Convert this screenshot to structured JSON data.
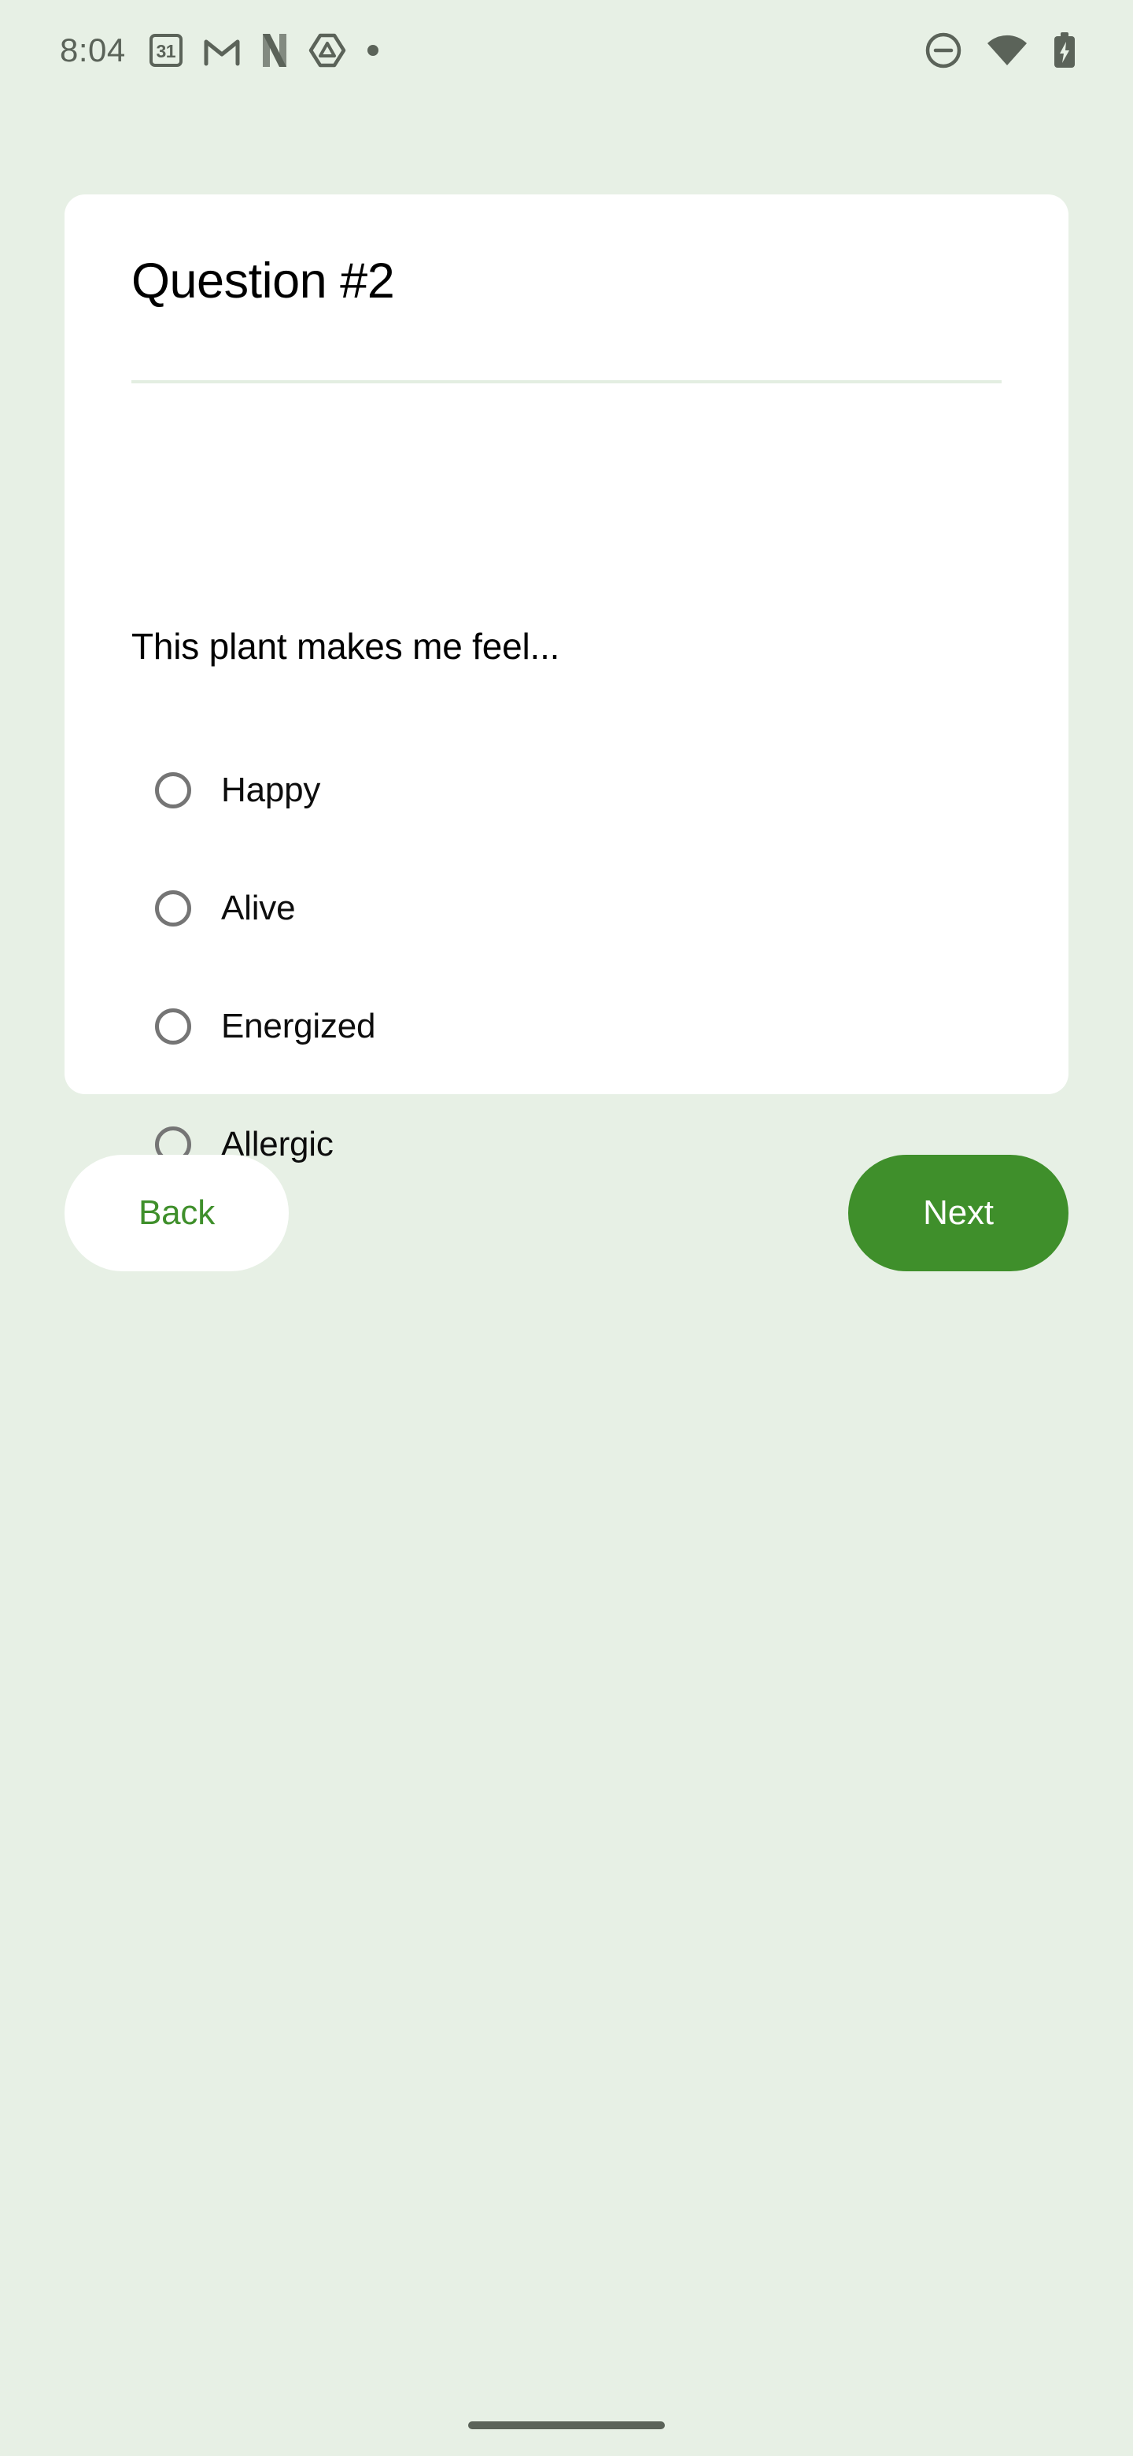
{
  "theme": {
    "background": "#e7f0e5",
    "card_background": "#ffffff",
    "accent_green": "#3f8f2b",
    "divider": "#e3eee1",
    "status_icon": "#5b6359",
    "radio_ring": "#757575",
    "text_primary": "#000000"
  },
  "status_bar": {
    "time": "8:04",
    "left_icons": [
      {
        "name": "calendar-icon",
        "label": "31"
      },
      {
        "name": "gmail-icon",
        "label": "M"
      },
      {
        "name": "netflix-icon",
        "label": "N"
      },
      {
        "name": "drive-triangle-icon",
        "label": ""
      },
      {
        "name": "more-notifications-dot-icon",
        "label": ""
      }
    ],
    "right_icons": [
      {
        "name": "do-not-disturb-icon",
        "label": ""
      },
      {
        "name": "wifi-icon",
        "label": ""
      },
      {
        "name": "battery-charging-icon",
        "label": ""
      }
    ]
  },
  "card": {
    "title": "Question #2",
    "question": "This plant makes me feel...",
    "options": [
      {
        "label": "Happy",
        "selected": false
      },
      {
        "label": "Alive",
        "selected": false
      },
      {
        "label": "Energized",
        "selected": false
      },
      {
        "label": "Allergic",
        "selected": false
      }
    ]
  },
  "footer": {
    "back_label": "Back",
    "next_label": "Next"
  },
  "system_nav": {
    "gesture_bar": "home-gesture-bar"
  }
}
